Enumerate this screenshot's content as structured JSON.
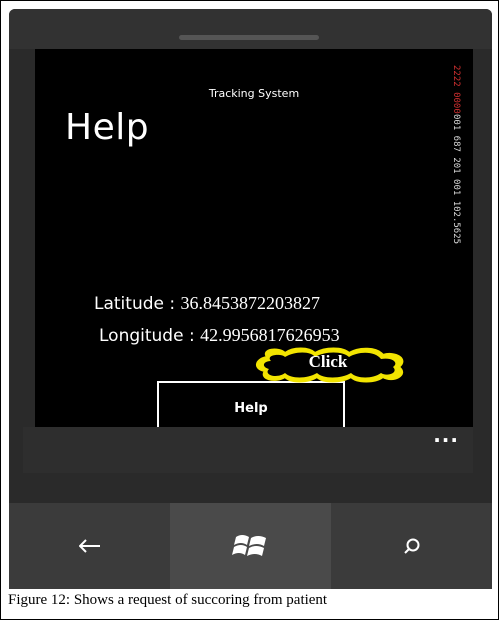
{
  "app": {
    "title": "Tracking System"
  },
  "page": {
    "title": "Help"
  },
  "side_readout": {
    "red": "2222 0000",
    "white": "001 687 201 001 102.5625"
  },
  "location": {
    "latitude_label": "Latitude :",
    "latitude_value": "36.8453872203827",
    "longitude_label": "Longitude :",
    "longitude_value": "42.9956817626953"
  },
  "callout": {
    "text": "Click",
    "color": "#f2e400"
  },
  "help_button": {
    "label": "Help"
  },
  "app_bar": {
    "more_label": "..."
  },
  "nav": {
    "back_glyph": "←",
    "search_glyph": "⚲"
  },
  "caption": "Figure 12:  Shows a request of succoring from patient"
}
